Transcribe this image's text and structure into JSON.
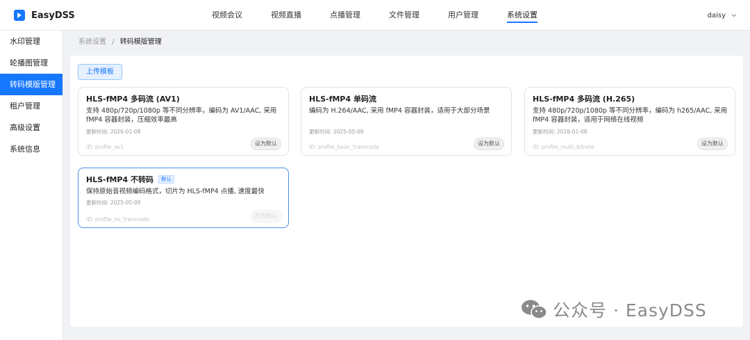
{
  "app": {
    "name": "EasyDSS"
  },
  "nav": {
    "items": [
      {
        "label": "视频会议",
        "active": false
      },
      {
        "label": "视频直播",
        "active": false
      },
      {
        "label": "点播管理",
        "active": false
      },
      {
        "label": "文件管理",
        "active": false
      },
      {
        "label": "用户管理",
        "active": false
      },
      {
        "label": "系统设置",
        "active": true
      }
    ]
  },
  "user": {
    "name": "daisy"
  },
  "sidebar": {
    "items": [
      {
        "label": "水印管理",
        "active": false
      },
      {
        "label": "轮播图管理",
        "active": false
      },
      {
        "label": "转码模版管理",
        "active": true
      },
      {
        "label": "租户管理",
        "active": false
      },
      {
        "label": "高级设置",
        "active": false
      },
      {
        "label": "系统信息",
        "active": false
      }
    ]
  },
  "breadcrumb": {
    "parent": "系统设置",
    "separator": "/",
    "current": "转码模版管理"
  },
  "toolbar": {
    "upload_label": "上传模板"
  },
  "cards": [
    {
      "title": "HLS-fMP4 多码流 (AV1)",
      "badge": "",
      "description": "支持 480p/720p/1080p 等不同分辨率，编码为 AV1/AAC, 采用 fMP4 容器封装，压缩效率最高",
      "updated": "更新时间: 2026-01-08",
      "id": "ID: profile_av1",
      "action": "设为默认"
    },
    {
      "title": "HLS-fMP4 单码流",
      "badge": "",
      "description": "编码为 H.264/AAC, 采用 fMP4 容器封装，适用于大部分场景",
      "updated": "更新时间: 2025-05-09",
      "id": "ID: profile_basic_transcode",
      "action": "设为默认"
    },
    {
      "title": "HLS-fMP4 多码流 (H.265)",
      "badge": "",
      "description": "支持 480p/720p/1080p 等不同分辨率，编码为 h265/AAC, 采用 fMP4 容器封装，适用于网络在线视频",
      "updated": "更新时间: 2026-01-08",
      "id": "ID: profile_multi_bitrate",
      "action": "设为默认"
    },
    {
      "title": "HLS-fMP4 不转码",
      "badge": "默认",
      "description": "保持原始音视频编码格式，切片为 HLS-fMP4 点播, 速度最快",
      "updated": "更新时间: 2025-05-09",
      "id": "ID: profile_no_transcode",
      "action": "已为默认"
    }
  ],
  "watermark": {
    "text": "公众号 · EasyDSS"
  },
  "colors": {
    "primary": "#1677ff",
    "background": "#f0f2f5",
    "selected_border": "#4a8fe8"
  }
}
